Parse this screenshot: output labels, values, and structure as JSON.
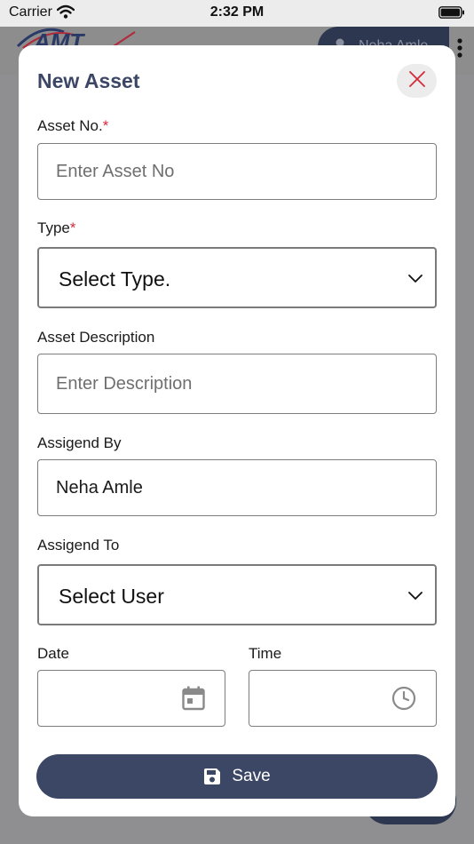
{
  "status_bar": {
    "carrier": "Carrier",
    "time": "2:32 PM"
  },
  "header": {
    "user_name": "Neha Amle"
  },
  "modal": {
    "title": "New Asset",
    "fields": {
      "asset_no": {
        "label": "Asset No.",
        "required_mark": "*",
        "placeholder": "Enter Asset No",
        "value": ""
      },
      "type": {
        "label": "Type",
        "required_mark": "*",
        "selected": "Select Type."
      },
      "description": {
        "label": "Asset Description",
        "placeholder": "Enter Description",
        "value": ""
      },
      "assigned_by": {
        "label": "Assigend By",
        "value": "Neha Amle"
      },
      "assigned_to": {
        "label": "Assigend To",
        "selected": "Select User"
      },
      "date": {
        "label": "Date",
        "icon": "calendar-icon"
      },
      "time": {
        "label": "Time",
        "icon": "clock-icon"
      }
    },
    "save_label": "Save"
  },
  "colors": {
    "primary": "#3c4766",
    "required": "#d52a3c",
    "overlay": "#8f8f91"
  }
}
